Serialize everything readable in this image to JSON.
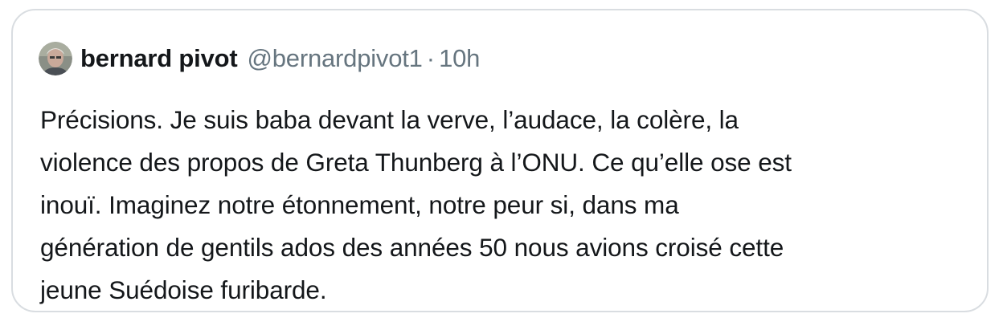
{
  "tweet": {
    "author": {
      "name": "bernard pivot",
      "handle": "@bernardpivot1",
      "avatar_icon": "user-avatar-photo"
    },
    "separator": "·",
    "timestamp": "10h",
    "lines": [
      "Précisions. Je suis baba devant la verve, l’audace, la colère, la",
      "violence des propos de Greta Thunberg à l’ONU. Ce qu’elle ose est",
      "inouï. Imaginez notre étonnement, notre peur si, dans ma",
      "génération de gentils ados des années 50 nous avions croisé cette",
      "jeune Suédoise furibarde."
    ]
  },
  "colors": {
    "border": "#d9dde1",
    "text": "#14171a",
    "secondary_text": "#66757f",
    "background": "#ffffff"
  }
}
